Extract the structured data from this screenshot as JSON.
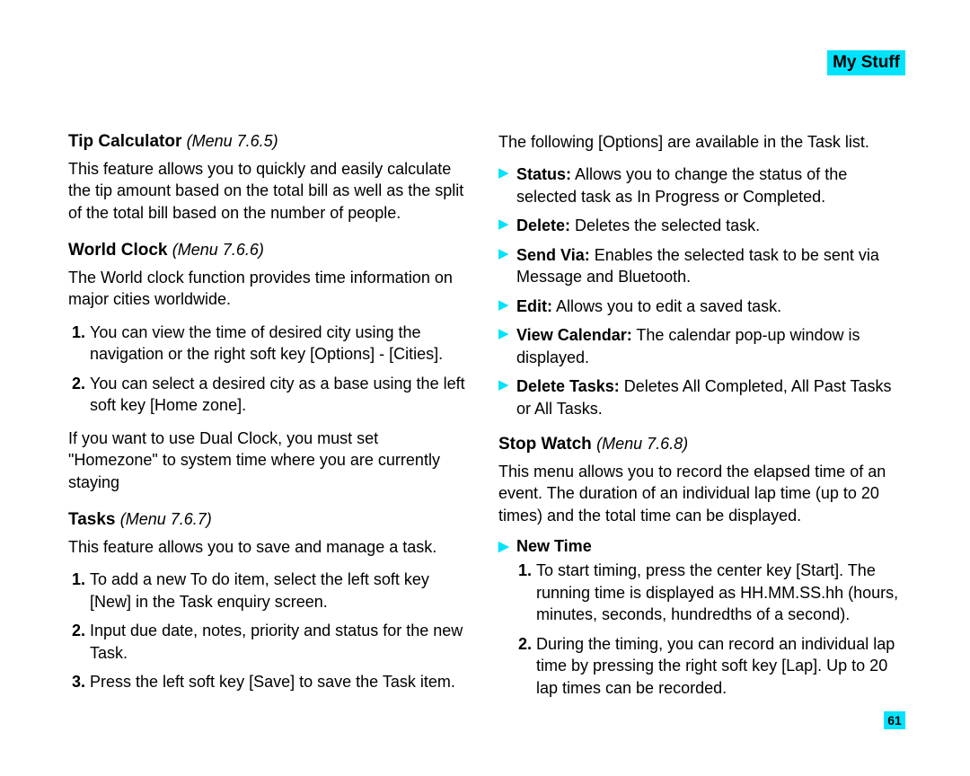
{
  "header": {
    "tab": "My Stuff"
  },
  "page_number": "61",
  "left": {
    "tip": {
      "title": "Tip Calculator",
      "menu": "(Menu 7.6.5)",
      "body": "This feature allows you to quickly and easily calculate the tip amount based on the total bill as well as the split of the total bill based on the number of people."
    },
    "world": {
      "title": "World Clock",
      "menu": "(Menu 7.6.6)",
      "body": "The World clock function provides time information on major cities worldwide.",
      "li1": "You can view the time of desired city using the navigation or the right soft key [Options] - [Cities].",
      "li2": "You can select a desired city as a base using the left soft key [Home zone].",
      "after": "If you want to use Dual Clock, you must set \"Homezone\" to system time where you are currently staying"
    },
    "tasks": {
      "title": "Tasks",
      "menu": "(Menu 7.6.7)",
      "body": "This feature allows you to save and manage a task.",
      "li1": "To add a new To do item, select the left soft key [New] in the Task enquiry screen.",
      "li2": "Input due date, notes, priority and status for the new Task.",
      "li3": "Press the left soft key [Save] to save the Task item."
    }
  },
  "right": {
    "intro": "The following [Options] are available in the Task list.",
    "opts": {
      "status_b": "Status:",
      "status_t": " Allows you to change the status of the selected task as In Progress or Completed.",
      "delete_b": "Delete:",
      "delete_t": " Deletes the selected task.",
      "send_b": "Send Via:",
      "send_t": " Enables the selected task to be sent via Message and Bluetooth.",
      "edit_b": "Edit:",
      "edit_t": " Allows you to edit a saved task.",
      "view_b": "View Calendar:",
      "view_t": " The calendar pop-up window is displayed.",
      "deltasks_b": "Delete Tasks:",
      "deltasks_t": " Deletes All Completed, All Past Tasks or All Tasks."
    },
    "stop": {
      "title": "Stop Watch",
      "menu": "(Menu 7.6.8)",
      "body": "This menu allows you to record the elapsed time of an event. The duration of an individual lap time (up to 20 times) and the total time can be displayed.",
      "newtime": "New Time",
      "li1": "To start timing, press the center key [Start]. The running time is displayed as HH.MM.SS.hh (hours, minutes, seconds, hundredths of a second).",
      "li2": "During the timing, you can record an individual lap time by pressing the right soft key [Lap]. Up to 20 lap times can be recorded."
    }
  }
}
